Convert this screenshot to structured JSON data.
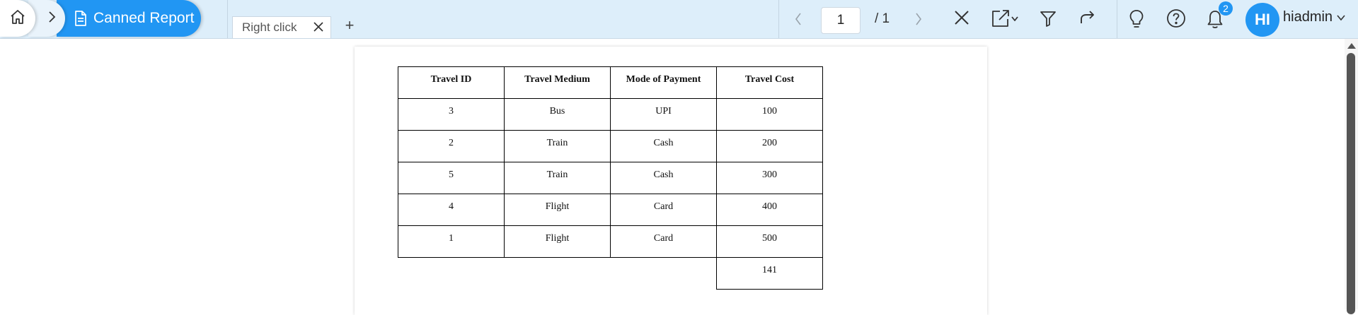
{
  "breadcrumb": {
    "home_icon": "home-icon",
    "separator_icon": "chevron-right-icon",
    "active_label": "Canned Report",
    "active_icon": "document-icon"
  },
  "tabs": [
    {
      "label": "Right click",
      "close_icon": "close-icon"
    }
  ],
  "add_tab_label": "+",
  "pagination": {
    "current_page": "1",
    "total_label": "/  1"
  },
  "toolbar": {
    "close_icon": "close-icon",
    "export_icon": "export-icon",
    "filter_icon": "filter-icon",
    "share_icon": "share-icon",
    "bulb_icon": "lightbulb-icon",
    "help_icon": "help-icon",
    "notifications_icon": "bell-icon",
    "notification_count": "2"
  },
  "user": {
    "initials": "HI",
    "name": "hiadmin"
  },
  "report": {
    "headers": [
      "Travel ID",
      "Travel Medium",
      "Mode of Payment",
      "Travel Cost"
    ],
    "rows": [
      [
        "3",
        "Bus",
        "UPI",
        "100"
      ],
      [
        "2",
        "Train",
        "Cash",
        "200"
      ],
      [
        "5",
        "Train",
        "Cash",
        "300"
      ],
      [
        "4",
        "Flight",
        "Card",
        "400"
      ],
      [
        "1",
        "Flight",
        "Card",
        "500"
      ]
    ],
    "total": "141"
  },
  "colors": {
    "topbar": "#ddeefa",
    "accent": "#2196f3"
  }
}
